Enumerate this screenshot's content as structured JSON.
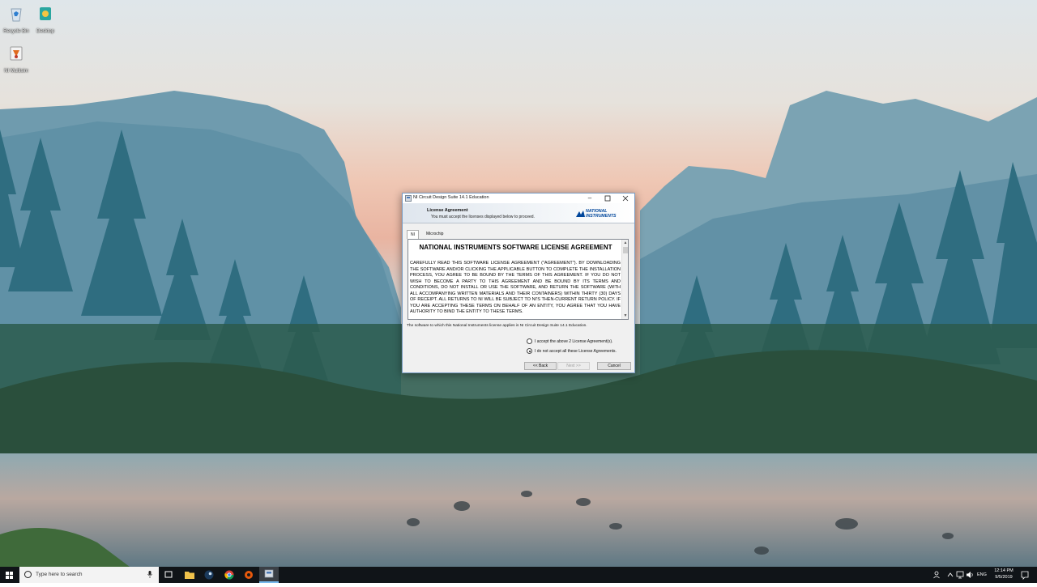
{
  "desktop": {
    "icons": [
      {
        "label": "Recycle Bin"
      },
      {
        "label": "Desktop"
      },
      {
        "label": "NI Multisim"
      }
    ]
  },
  "dialog": {
    "title": "NI Circuit Design Suite 14.1 Education",
    "header_title": "License Agreement",
    "header_subtitle": "You must accept the licenses displayed below to proceed.",
    "logo_line1": "NATIONAL",
    "logo_line2": "INSTRUMENTS",
    "tabs": [
      "NI",
      "Microchip"
    ],
    "license_heading": "NATIONAL INSTRUMENTS SOFTWARE LICENSE AGREEMENT",
    "license_body": "CAREFULLY READ THIS SOFTWARE LICENSE AGREEMENT (\"AGREEMENT\"). BY DOWNLOADING THE SOFTWARE AND/OR CLICKING THE APPLICABLE BUTTON TO COMPLETE THE INSTALLATION PROCESS, YOU AGREE TO BE BOUND BY THE TERMS OF THIS AGREEMENT. IF YOU DO NOT WISH TO BECOME A PARTY TO THIS AGREEMENT AND BE BOUND BY ITS TERMS AND CONDITIONS, DO NOT INSTALL OR USE THE SOFTWARE, AND RETURN THE SOFTWARE (WITH ALL ACCOMPANYING WRITTEN MATERIALS AND THEIR CONTAINERS) WITHIN THIRTY (30) DAYS OF RECEIPT. ALL RETURNS TO NI WILL BE SUBJECT TO NI'S THEN-CURRENT RETURN POLICY. IF YOU ARE ACCEPTING THESE TERMS ON BEHALF OF AN ENTITY, YOU AGREE THAT YOU HAVE AUTHORITY TO BIND THE ENTITY TO THESE TERMS.",
    "applies_text": "The software to which this National Instruments license applies is NI Circuit Design Suite 14.1 Education.",
    "radio_accept": "I accept the above 2 License Agreement(s).",
    "radio_decline": "I do not accept all these License Agreements.",
    "selected_radio": "decline",
    "btn_back": "<< Back",
    "btn_next": "Next >>",
    "btn_cancel": "Cancel"
  },
  "taskbar": {
    "search_placeholder": "Type here to search",
    "language": "ENG",
    "time": "12:14 PM",
    "date": "9/5/2019"
  },
  "colors": {
    "accent": "#00469b",
    "taskbar": "#101418",
    "dialog_border": "#7a9cc4"
  }
}
